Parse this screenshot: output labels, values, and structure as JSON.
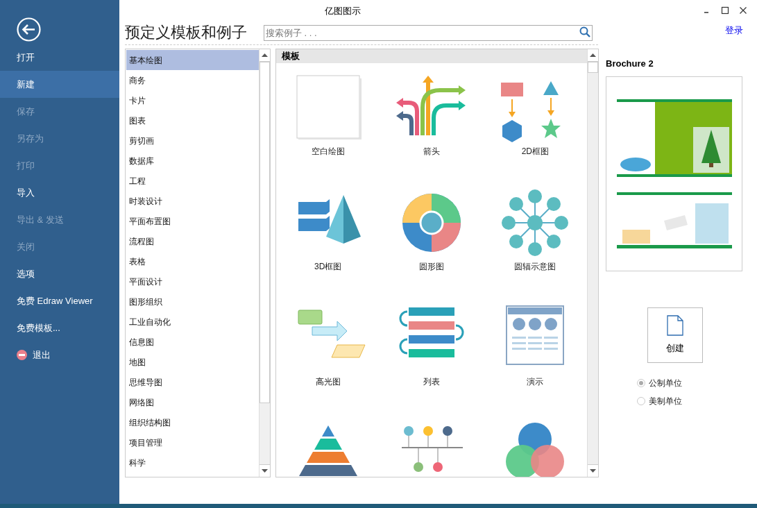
{
  "window": {
    "title": "亿图图示",
    "login": "登录"
  },
  "sidebar": {
    "items": [
      {
        "label": "打开",
        "kind": "plain",
        "selected": false,
        "disabled": false
      },
      {
        "label": "新建",
        "kind": "plain",
        "selected": true,
        "disabled": false
      },
      {
        "label": "保存",
        "kind": "plain",
        "selected": false,
        "disabled": true
      },
      {
        "label": "另存为",
        "kind": "plain",
        "selected": false,
        "disabled": true
      },
      {
        "label": "打印",
        "kind": "plain",
        "selected": false,
        "disabled": true
      },
      {
        "label": "导入",
        "kind": "plain",
        "selected": false,
        "disabled": false
      },
      {
        "label": "导出 & 发送",
        "kind": "plain",
        "selected": false,
        "disabled": true
      },
      {
        "label": "关闭",
        "kind": "plain",
        "selected": false,
        "disabled": true
      },
      {
        "label": "选项",
        "kind": "plain",
        "selected": false,
        "disabled": false
      },
      {
        "label": "免费 Edraw Viewer",
        "kind": "plain",
        "selected": false,
        "disabled": false
      },
      {
        "label": "免费模板...",
        "kind": "plain",
        "selected": false,
        "disabled": false
      },
      {
        "label": "退出",
        "kind": "exit",
        "selected": false,
        "disabled": false
      }
    ]
  },
  "heading": "预定义模板和例子",
  "search": {
    "placeholder": "搜索例子 . . ."
  },
  "categories": [
    {
      "label": "基本绘图",
      "selected": true
    },
    {
      "label": "商务",
      "selected": false
    },
    {
      "label": "卡片",
      "selected": false
    },
    {
      "label": "图表",
      "selected": false
    },
    {
      "label": "剪切画",
      "selected": false
    },
    {
      "label": "数据库",
      "selected": false
    },
    {
      "label": "工程",
      "selected": false
    },
    {
      "label": "时装设计",
      "selected": false
    },
    {
      "label": "平面布置图",
      "selected": false
    },
    {
      "label": "流程图",
      "selected": false
    },
    {
      "label": "表格",
      "selected": false
    },
    {
      "label": "平面设计",
      "selected": false
    },
    {
      "label": "图形组织",
      "selected": false
    },
    {
      "label": "工业自动化",
      "selected": false
    },
    {
      "label": "信息图",
      "selected": false
    },
    {
      "label": "地图",
      "selected": false
    },
    {
      "label": "思维导图",
      "selected": false
    },
    {
      "label": "网络图",
      "selected": false
    },
    {
      "label": "组织结构图",
      "selected": false
    },
    {
      "label": "项目管理",
      "selected": false
    },
    {
      "label": "科学",
      "selected": false
    }
  ],
  "templates": {
    "title": "模板",
    "items": [
      {
        "kind": "blank",
        "label": "空白绘图"
      },
      {
        "kind": "arrows",
        "label": "箭头"
      },
      {
        "kind": "blocks2d",
        "label": "2D框图"
      },
      {
        "kind": "blocks3d",
        "label": "3D框图"
      },
      {
        "kind": "circular",
        "label": "圆形图"
      },
      {
        "kind": "radial",
        "label": "圆辐示意图"
      },
      {
        "kind": "highlight",
        "label": "高光图"
      },
      {
        "kind": "list",
        "label": "列表"
      },
      {
        "kind": "presentation",
        "label": "演示"
      },
      {
        "kind": "pyramid"
      },
      {
        "kind": "timeline"
      },
      {
        "kind": "venn"
      }
    ]
  },
  "preview": {
    "title": "Brochure 2",
    "kind": "picture"
  },
  "create_button": "创建",
  "units": [
    {
      "label": "公制单位",
      "selected": true
    },
    {
      "label": "美制单位",
      "selected": false
    }
  ]
}
